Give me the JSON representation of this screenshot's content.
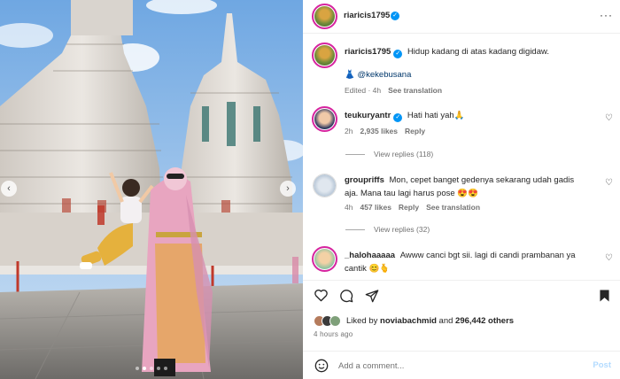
{
  "post": {
    "author": "riaricis1795",
    "caption_user": "riaricis1795",
    "caption_text": "Hidup kadang di atas kadang digidaw.",
    "caption_mention": "@kekebusana",
    "caption_mention_emoji": "👗",
    "caption_meta": "Edited · 4h",
    "see_translation": "See translation"
  },
  "media": {
    "slide_count": 5,
    "active_slide": 2
  },
  "comments": [
    {
      "user": "teukuryantr",
      "verified": true,
      "text": "Hati hati yah🙏",
      "time": "2h",
      "likes": "2,935 likes",
      "reply": "Reply",
      "view_replies": "View replies (118)"
    },
    {
      "user": "groupriffs",
      "verified": false,
      "text_line1": "Mon, cepet banget gedenya sekarang udah gadis",
      "text_line2": "aja. Mana tau lagi harus pose 😍😍",
      "time": "4h",
      "likes": "457 likes",
      "reply": "Reply",
      "see_translation": "See translation",
      "view_replies": "View replies (32)"
    },
    {
      "user": "_halohaaaaa",
      "verified": false,
      "text_line1": "Awww canci bgt sii. lagi di candi prambanan ya",
      "text_line2": "cantik 😊🫰"
    }
  ],
  "likes": {
    "liked_by_prefix": "Liked by",
    "liked_by_user": "noviabachmid",
    "and": "and",
    "others": "296,442 others"
  },
  "timestamp": "4 hours ago",
  "composer": {
    "placeholder": "Add a comment...",
    "post_label": "Post"
  },
  "icons": {
    "like": "heart-icon",
    "comment": "comment-icon",
    "share": "paper-plane-icon",
    "save": "bookmark-icon",
    "emoji": "smiley-icon",
    "more": "more-dots-icon",
    "verified": "verified-badge-icon"
  },
  "colors": {
    "accent": "#0095f6",
    "story_ring": "#d6249f",
    "muted": "#737373",
    "post_disabled": "#b3dbff"
  }
}
